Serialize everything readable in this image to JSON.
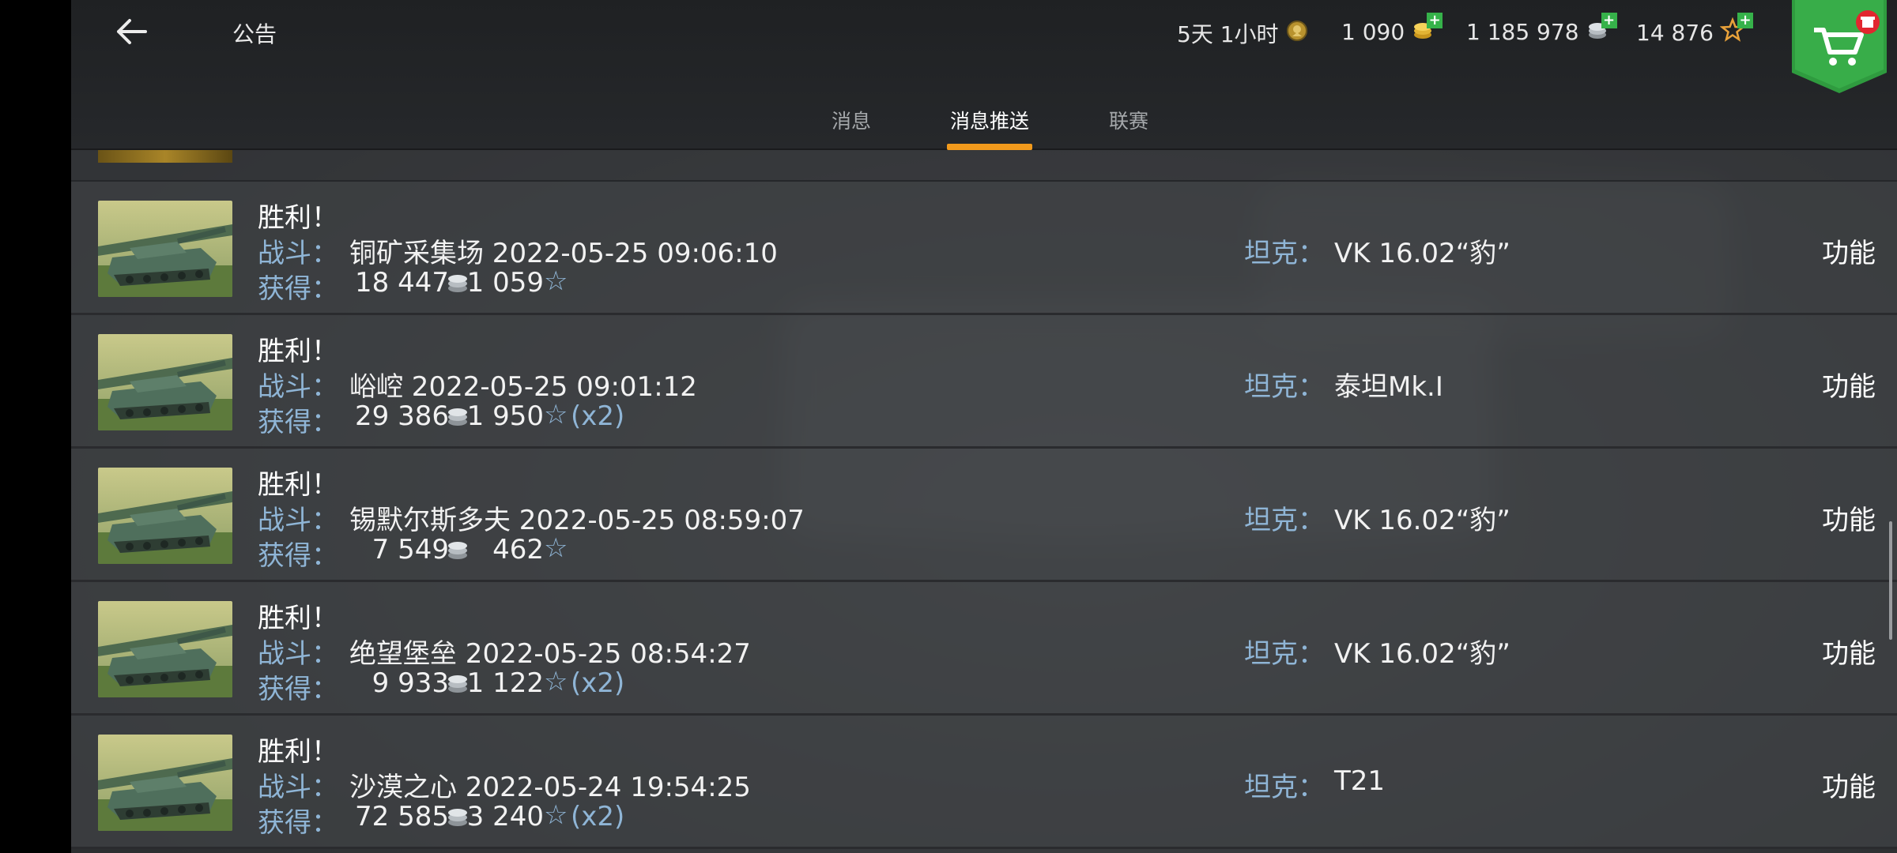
{
  "header": {
    "title": "公告",
    "timer": "5天 1小时",
    "gold": "1 090",
    "silver": "1 185 978",
    "free_xp": "14 876",
    "plus": "+"
  },
  "tabs": [
    {
      "label": "消息",
      "active": false
    },
    {
      "label": "消息推送",
      "active": true
    },
    {
      "label": "联赛",
      "active": false
    }
  ],
  "labels": {
    "victory": "胜利！",
    "battle": "战斗：",
    "reward": "获得：",
    "tank": "坦克：",
    "function": "功能",
    "star": "☆"
  },
  "rows": [
    {
      "battle": "铜矿采集场 2022-05-25 09:06:10",
      "credits": "18 447",
      "xp": "1 059",
      "multiplier": "",
      "tank": "VK 16.02“豹”"
    },
    {
      "battle": "峪崆 2022-05-25 09:01:12",
      "credits": "29 386",
      "xp": "1 950",
      "multiplier": "(x2)",
      "tank": "泰坦Mk.I"
    },
    {
      "battle": "锡默尔斯多夫 2022-05-25 08:59:07",
      "credits": "7 549",
      "xp": "462",
      "multiplier": "",
      "tank": "VK 16.02“豹”"
    },
    {
      "battle": "绝望堡垒 2022-05-25 08:54:27",
      "credits": "9 933",
      "xp": "1 122",
      "multiplier": "(x2)",
      "tank": "VK 16.02“豹”"
    },
    {
      "battle": "沙漠之心 2022-05-24 19:54:25",
      "credits": "72 585",
      "xp": "3 240",
      "multiplier": "(x2)",
      "tank": "T21"
    }
  ],
  "colors": {
    "accent": "#f29a1c",
    "label_blue": "#8fb5d6",
    "shop_green": "#2f9b3f",
    "plus_green": "#36b24a"
  }
}
